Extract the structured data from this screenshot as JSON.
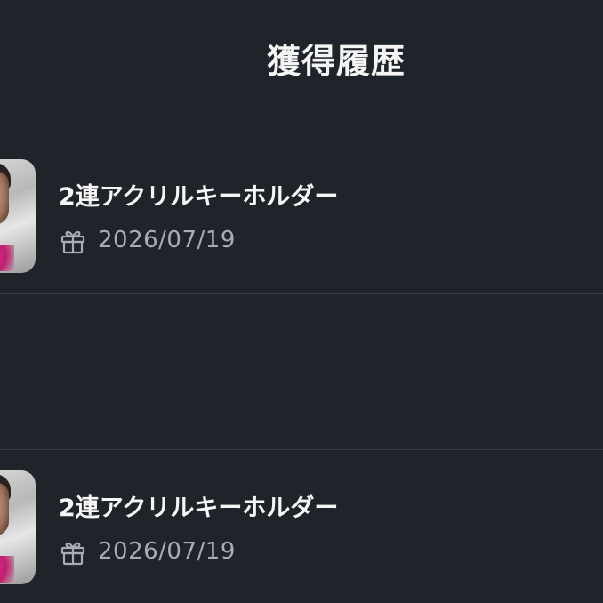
{
  "header": {
    "title": "獲得履歴"
  },
  "history": {
    "items": [
      {
        "name": "2連アクリルキーホルダー",
        "date": "2026/07/19"
      },
      {
        "name": "2連アクリルキーホルダー",
        "date": "2026/07/19"
      }
    ]
  },
  "colors": {
    "background": "#1f232a",
    "text_primary": "#f5f5f5",
    "text_secondary": "#a9adb3",
    "divider": "#3a3f46"
  },
  "icons": {
    "date_icon": "gift-icon"
  }
}
